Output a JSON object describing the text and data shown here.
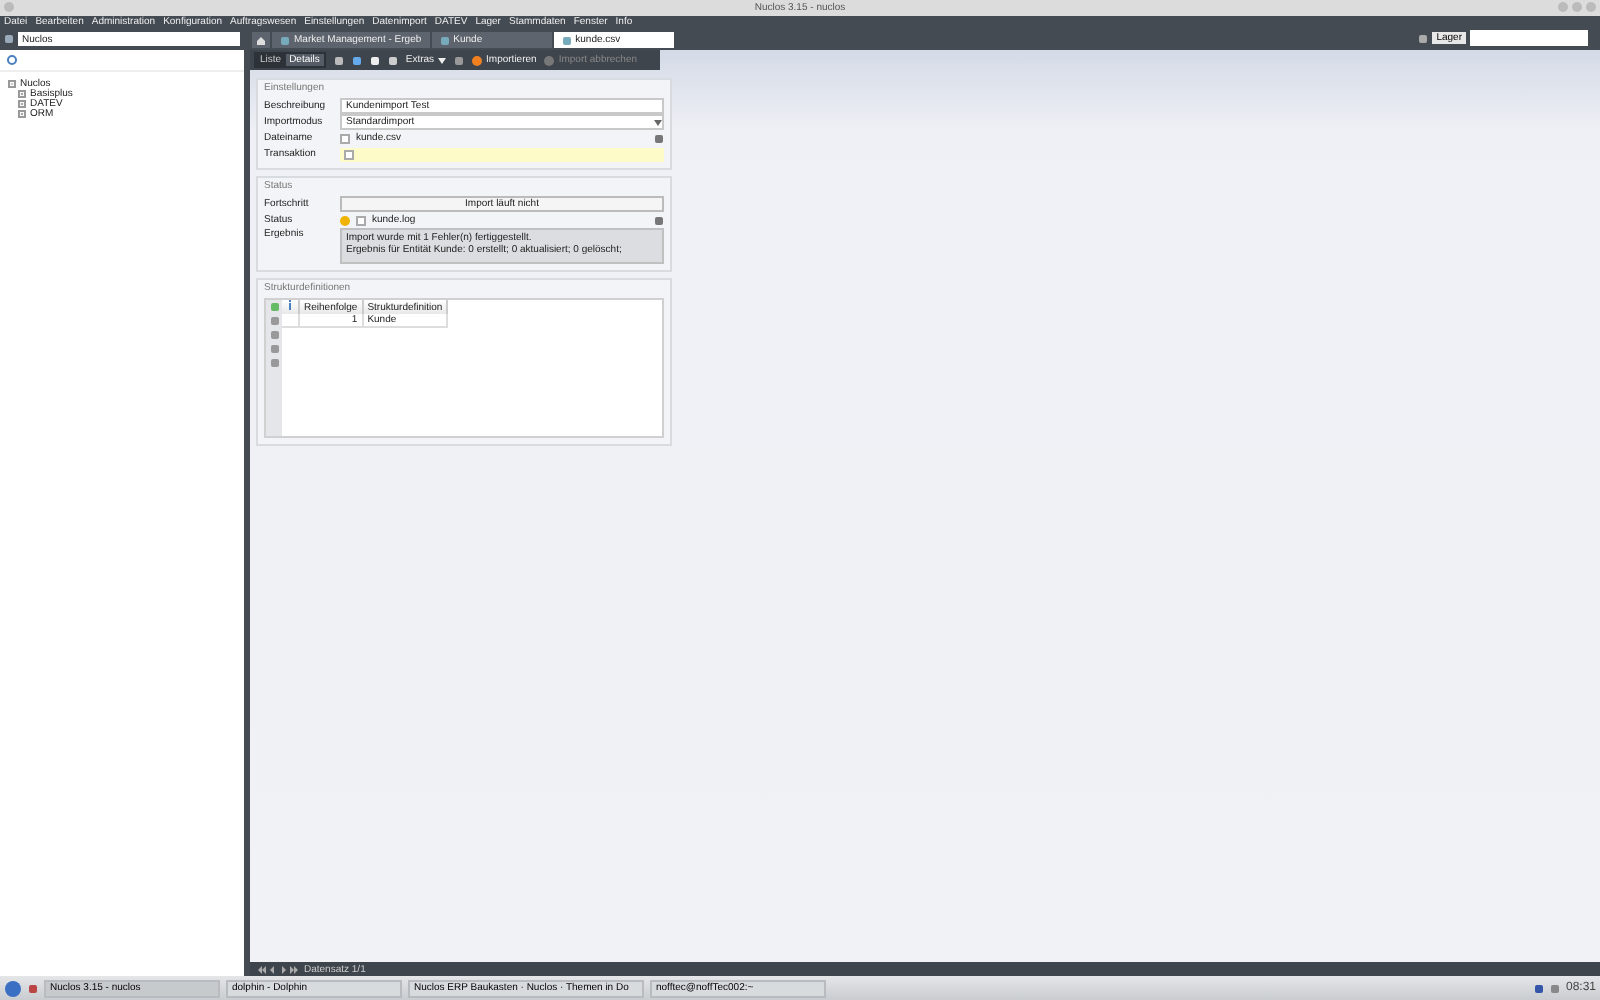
{
  "window": {
    "title": "Nuclos 3.15 - nuclos"
  },
  "menu": [
    "Datei",
    "Bearbeiten",
    "Administration",
    "Konfiguration",
    "Auftragswesen",
    "Einstellungen",
    "Datenimport",
    "DATEV",
    "Lager",
    "Stammdaten",
    "Fenster",
    "Info"
  ],
  "navigator": {
    "title": "Nuclos"
  },
  "tabs": [
    {
      "label": "Market Management - Ergeb",
      "selected": false
    },
    {
      "label": "Kunde",
      "selected": false
    },
    {
      "label": "kunde.csv",
      "selected": true
    }
  ],
  "location": {
    "label": "Lager"
  },
  "tree": [
    {
      "label": "Nuclos",
      "expanded": true,
      "children": [
        {
          "label": "Basisplus",
          "expanded": false
        },
        {
          "label": "DATEV",
          "expanded": false
        },
        {
          "label": "ORM",
          "expanded": false
        }
      ]
    }
  ],
  "toolbar": {
    "views": [
      {
        "label": "Liste",
        "selected": false
      },
      {
        "label": "Details",
        "selected": true
      }
    ],
    "extras": "Extras",
    "actions": [
      {
        "label": "Importieren",
        "disabled": false
      },
      {
        "label": "Import abbrechen",
        "disabled": true
      }
    ]
  },
  "settings": {
    "title": "Einstellungen",
    "beschreibung": {
      "label": "Beschreibung",
      "value": "Kundenimport Test"
    },
    "importmodus": {
      "label": "Importmodus",
      "value": "Standardimport"
    },
    "dateiname": {
      "label": "Dateiname",
      "value": "kunde.csv",
      "checked": false
    },
    "transaktion": {
      "label": "Transaktion",
      "checked": false
    }
  },
  "status": {
    "title": "Status",
    "fortschritt": {
      "label": "Fortschritt",
      "value": "Import läuft nicht"
    },
    "status": {
      "label": "Status",
      "color": "#f0b400",
      "file": "kunde.log",
      "checked": false
    },
    "ergebnis": {
      "label": "Ergebnis",
      "lines": [
        "Import wurde mit 1 Fehler(n) fertiggestellt.",
        "Ergebnis für Entität Kunde:  0 erstellt;  0 aktualisiert;  0 gelöscht;"
      ]
    }
  },
  "structures": {
    "title": "Strukturdefinitionen",
    "columns": [
      "Reihenfolge",
      "Strukturdefinition"
    ],
    "rows": [
      [
        "1",
        "Kunde"
      ]
    ]
  },
  "status_bar": {
    "text": "Datensatz 1/1"
  },
  "taskbar": {
    "tasks": [
      {
        "label": "Nuclos 3.15 - nuclos",
        "selected": true
      },
      {
        "label": "dolphin - Dolphin",
        "selected": false
      },
      {
        "label": "Nuclos ERP Baukasten · Nuclos · Themen in Do",
        "selected": false
      },
      {
        "label": "nofftec@noffTec002:~",
        "selected": false
      }
    ],
    "clock": "08:31"
  }
}
